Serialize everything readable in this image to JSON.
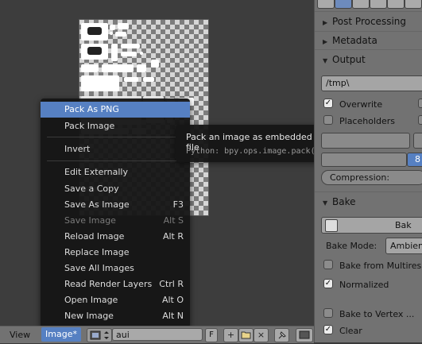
{
  "header": {
    "view_label": "View",
    "image_menu_label": "Image*",
    "image_name": "aui",
    "fake_user_label": "F"
  },
  "image_menu": {
    "items": [
      {
        "label": "Pack As PNG",
        "shortcut": ""
      },
      {
        "label": "Pack Image",
        "shortcut": ""
      },
      {
        "label": "Invert",
        "shortcut": ""
      },
      {
        "label": "Edit Externally",
        "shortcut": ""
      },
      {
        "label": "Save a Copy",
        "shortcut": ""
      },
      {
        "label": "Save As Image",
        "shortcut": "F3"
      },
      {
        "label": "Save Image",
        "shortcut": "Alt S"
      },
      {
        "label": "Reload Image",
        "shortcut": "Alt R"
      },
      {
        "label": "Replace Image",
        "shortcut": ""
      },
      {
        "label": "Save All Images",
        "shortcut": ""
      },
      {
        "label": "Read Render Layers",
        "shortcut": "Ctrl R"
      },
      {
        "label": "Open Image",
        "shortcut": "Alt O"
      },
      {
        "label": "New Image",
        "shortcut": "Alt N"
      }
    ]
  },
  "tooltip": {
    "title": "Pack an image as embedded data into the .blend file",
    "python": "Python: bpy.ops.image.pack(as_png=True)"
  },
  "properties": {
    "sections": {
      "post_processing": "Post Processing",
      "metadata": "Metadata",
      "output": "Output",
      "bake": "Bake"
    },
    "output_path": "/tmp\\",
    "overwrite_label": "Overwrite",
    "overwrite_checked": true,
    "placeholders_label": "Placeholders",
    "depth_value": "8",
    "compression_label": "Compression:",
    "bake_button_label": "Bak",
    "bake_mode_label": "Bake Mode:",
    "bake_mode_value": "Ambien",
    "bake_from_multires_label": "Bake from Multires",
    "normalized_label": "Normalized",
    "bake_to_vertex_label": "Bake to Vertex ...",
    "clear_label": "Clear"
  },
  "colors": {
    "highlight": "#5680c2",
    "menu_bg": "#161616",
    "panel_bg": "#727272"
  }
}
